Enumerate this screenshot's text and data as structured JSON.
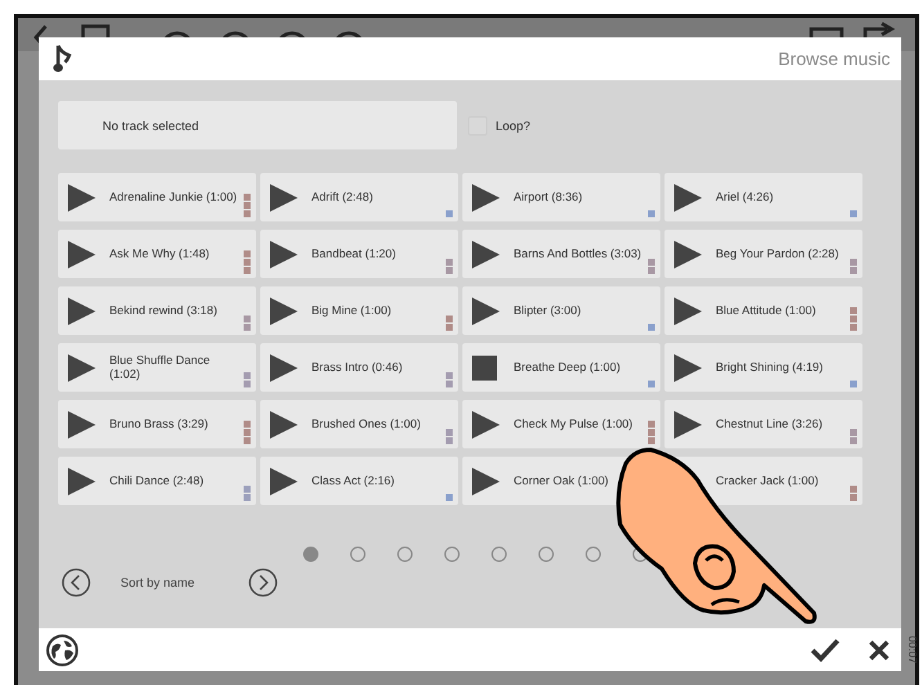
{
  "dialog": {
    "title": "Browse music"
  },
  "selection": {
    "placeholder": "No track selected"
  },
  "loop": {
    "label": "Loop?",
    "checked": false
  },
  "tracks": [
    {
      "label": "Adrenaline Junkie (1:00)",
      "playing": false,
      "tags": [
        {
          "color": "#b08c88"
        },
        {
          "color": "#b08c88"
        },
        {
          "color": "#b08c88"
        }
      ]
    },
    {
      "label": "Adrift (2:48)",
      "playing": false,
      "tags": [
        {
          "color": "#8aa0cc"
        }
      ]
    },
    {
      "label": "Airport (8:36)",
      "playing": false,
      "tags": [
        {
          "color": "#8aa0cc"
        }
      ]
    },
    {
      "label": "Ariel (4:26)",
      "playing": false,
      "tags": [
        {
          "color": "#8aa0cc"
        }
      ]
    },
    {
      "label": "Ask Me Why (1:48)",
      "playing": false,
      "tags": [
        {
          "color": "#b08c88"
        },
        {
          "color": "#b08c88"
        },
        {
          "color": "#b08c88"
        }
      ]
    },
    {
      "label": "Bandbeat (1:20)",
      "playing": false,
      "tags": [
        {
          "color": "#a898a4"
        },
        {
          "color": "#a898a4"
        }
      ]
    },
    {
      "label": "Barns And Bottles (3:03)",
      "playing": false,
      "tags": [
        {
          "color": "#a898a4"
        },
        {
          "color": "#a898a4"
        }
      ]
    },
    {
      "label": "Beg Your Pardon (2:28)",
      "playing": false,
      "tags": [
        {
          "color": "#a898a4"
        },
        {
          "color": "#a898a4"
        }
      ]
    },
    {
      "label": "Bekind rewind (3:18)",
      "playing": false,
      "tags": [
        {
          "color": "#a898a4"
        },
        {
          "color": "#a898a4"
        }
      ]
    },
    {
      "label": "Big Mine (1:00)",
      "playing": false,
      "tags": [
        {
          "color": "#b08c88"
        },
        {
          "color": "#b08c88"
        }
      ]
    },
    {
      "label": "Blipter (3:00)",
      "playing": false,
      "tags": [
        {
          "color": "#8aa0cc"
        }
      ]
    },
    {
      "label": "Blue Attitude (1:00)",
      "playing": false,
      "tags": [
        {
          "color": "#b08c88"
        },
        {
          "color": "#b08c88"
        },
        {
          "color": "#b08c88"
        }
      ]
    },
    {
      "label": "Blue Shuffle Dance (1:02)",
      "playing": false,
      "tags": [
        {
          "color": "#a49cb0"
        },
        {
          "color": "#a49cb0"
        }
      ]
    },
    {
      "label": "Brass Intro (0:46)",
      "playing": false,
      "tags": [
        {
          "color": "#a49cb0"
        },
        {
          "color": "#a49cb0"
        }
      ]
    },
    {
      "label": "Breathe Deep (1:00)",
      "playing": true,
      "tags": [
        {
          "color": "#8aa0cc"
        }
      ]
    },
    {
      "label": "Bright Shining (4:19)",
      "playing": false,
      "tags": [
        {
          "color": "#8aa0cc"
        }
      ]
    },
    {
      "label": "Bruno Brass (3:29)",
      "playing": false,
      "tags": [
        {
          "color": "#b08c88"
        },
        {
          "color": "#b08c88"
        },
        {
          "color": "#b08c88"
        }
      ]
    },
    {
      "label": "Brushed Ones (1:00)",
      "playing": false,
      "tags": [
        {
          "color": "#a49cb0"
        },
        {
          "color": "#a49cb0"
        }
      ]
    },
    {
      "label": "Check My Pulse (1:00)",
      "playing": false,
      "tags": [
        {
          "color": "#b08c88"
        },
        {
          "color": "#b08c88"
        },
        {
          "color": "#b08c88"
        }
      ]
    },
    {
      "label": "Chestnut Line (3:26)",
      "playing": false,
      "tags": [
        {
          "color": "#a898a4"
        },
        {
          "color": "#a898a4"
        }
      ]
    },
    {
      "label": "Chili Dance (2:48)",
      "playing": false,
      "tags": [
        {
          "color": "#9ca0bc"
        },
        {
          "color": "#9ca0bc"
        }
      ]
    },
    {
      "label": "Class Act (2:16)",
      "playing": false,
      "tags": [
        {
          "color": "#8aa0cc"
        }
      ]
    },
    {
      "label": "Corner Oak (1:00)",
      "playing": false
    },
    {
      "label": "Cracker Jack (1:00)",
      "tags": [
        {
          "color": "#b08c88"
        },
        {
          "color": "#b08c88"
        }
      ]
    }
  ],
  "pages": [
    {
      "selected": true
    },
    {
      "selected": false
    },
    {
      "selected": false
    },
    {
      "selected": false
    },
    {
      "selected": false
    },
    {
      "selected": false
    },
    {
      "selected": false
    },
    {
      "selected": false
    }
  ],
  "sort": {
    "label": "Sort by name"
  },
  "side_time": "00:07"
}
